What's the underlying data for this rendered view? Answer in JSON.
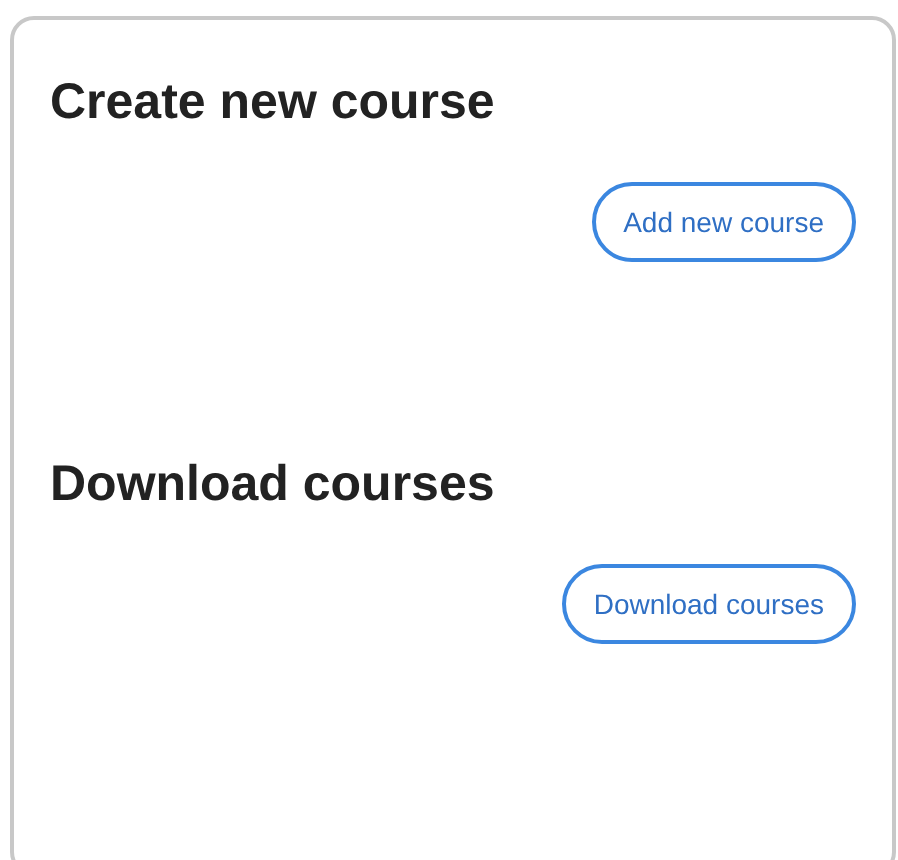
{
  "sections": [
    {
      "heading": "Create new course",
      "button": "Add new course"
    },
    {
      "heading": "Download courses",
      "button": "Download courses"
    }
  ]
}
